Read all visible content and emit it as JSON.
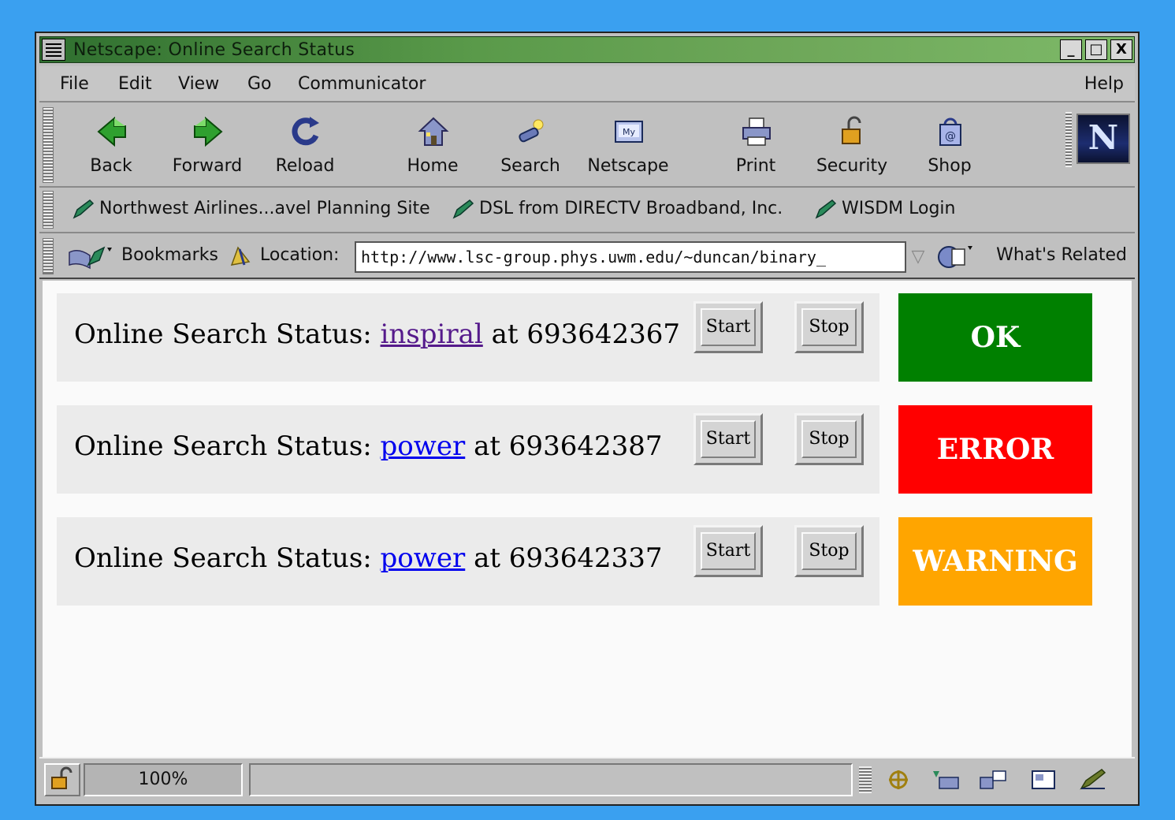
{
  "window": {
    "title": "Netscape: Online Search Status",
    "controls": {
      "minimize": "_",
      "maximize": "□",
      "close": "X"
    }
  },
  "menubar": {
    "items": [
      "File",
      "Edit",
      "View",
      "Go",
      "Communicator"
    ],
    "help": "Help"
  },
  "toolbar": {
    "buttons": [
      {
        "label": "Back",
        "icon": "back-arrow-icon"
      },
      {
        "label": "Forward",
        "icon": "forward-arrow-icon"
      },
      {
        "label": "Reload",
        "icon": "reload-icon"
      },
      {
        "label": "Home",
        "icon": "home-icon"
      },
      {
        "label": "Search",
        "icon": "search-icon"
      },
      {
        "label": "Netscape",
        "icon": "my-netscape-icon"
      },
      {
        "label": "Print",
        "icon": "printer-icon"
      },
      {
        "label": "Security",
        "icon": "padlock-icon"
      },
      {
        "label": "Shop",
        "icon": "shop-bag-icon"
      }
    ],
    "logo_letter": "N"
  },
  "personal_toolbar": {
    "bookmarks": [
      "Northwest Airlines...avel Planning Site",
      "DSL from DIRECTV Broadband, Inc.",
      "WISDM Login"
    ]
  },
  "location_bar": {
    "bookmarks_label": "Bookmarks",
    "location_label": "Location:",
    "url": "http://www.lsc-group.phys.uwm.edu/~duncan/binary_",
    "whats_related": "What's Related"
  },
  "content": {
    "rows": [
      {
        "prefix": "Online Search Status:",
        "link": "inspiral",
        "link_visited": true,
        "suffix": "at 693642367",
        "start_label": "Start",
        "stop_label": "Stop",
        "status": "OK",
        "status_color": "#008000"
      },
      {
        "prefix": "Online Search Status:",
        "link": "power",
        "link_visited": false,
        "suffix": "at 693642387",
        "start_label": "Start",
        "stop_label": "Stop",
        "status": "ERROR",
        "status_color": "#ff0000"
      },
      {
        "prefix": "Online Search Status:",
        "link": "power",
        "link_visited": false,
        "suffix": "at 693642337",
        "start_label": "Start",
        "stop_label": "Stop",
        "status": "WARNING",
        "status_color": "#ffa500"
      }
    ]
  },
  "statusbar": {
    "progress": "100%",
    "icons": [
      "navigator-icon",
      "mail-icon",
      "discussions-icon",
      "composer-icon",
      "address-book-icon"
    ]
  },
  "colors": {
    "desktop": "#3aa0f0",
    "link": "#0000ee",
    "visited_link": "#551a8b"
  }
}
